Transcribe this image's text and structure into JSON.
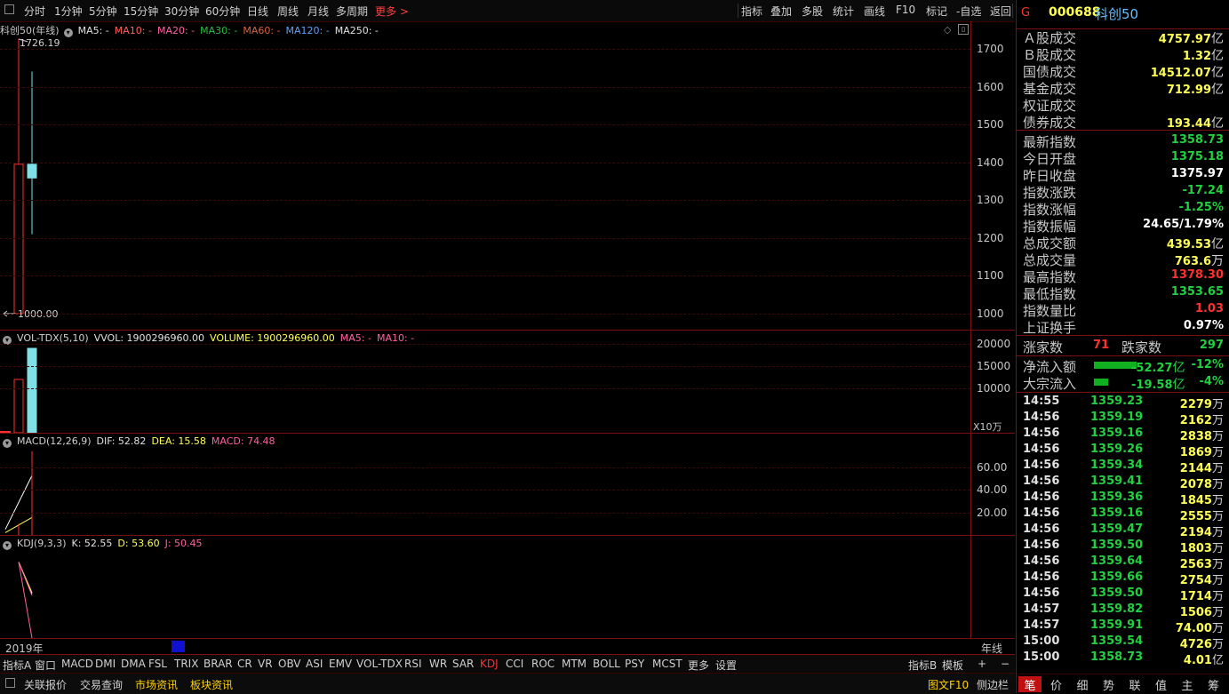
{
  "toolbar": {
    "left_items": [
      "分时",
      "1分钟",
      "5分钟",
      "15分钟",
      "30分钟",
      "60分钟",
      "日线",
      "周线",
      "月线",
      "多周期"
    ],
    "more_label": "更多 >",
    "right_items": [
      "指标",
      "叠加",
      "多股",
      "统计",
      "画线",
      "F10",
      "标记",
      "-自选",
      "返回"
    ]
  },
  "main_panel": {
    "name": "科创50(年线)",
    "ma_labels": [
      {
        "text": "MA5: -",
        "color": "#e0e0e0"
      },
      {
        "text": "MA10: -",
        "color": "#ff6060"
      },
      {
        "text": "MA20: -",
        "color": "#ff60a0"
      },
      {
        "text": "MA30: -",
        "color": "#20c040"
      },
      {
        "text": "MA60: -",
        "color": "#e06040"
      },
      {
        "text": "MA120: -",
        "color": "#60a0ff"
      },
      {
        "text": "MA250: -",
        "color": "#e0e0e0"
      }
    ],
    "y_ticks": [
      "1700",
      "1600",
      "1500",
      "1400",
      "1300",
      "1200",
      "1100",
      "1000"
    ],
    "high_label": "1726.19",
    "low_label": "1000.00"
  },
  "chart_data": [
    {
      "type": "candlestick",
      "title": "科创50(年线)",
      "ylim": [
        980,
        1760
      ],
      "candles": [
        {
          "open": 1000.0,
          "close": 1395.0,
          "high": 1726.19,
          "low": 1000.0,
          "color": "#ff3030"
        },
        {
          "open": 1395.0,
          "close": 1358.73,
          "high": 1640.0,
          "low": 1210.0,
          "color": "#80e0e8"
        }
      ]
    },
    {
      "type": "bar",
      "title": "VOL-TDX(5,10)",
      "ylim": [
        0,
        20000
      ],
      "values": [
        12000,
        19002
      ],
      "colors": [
        "#ff3030",
        "#80e0e8"
      ],
      "y_ticks": [
        "20000",
        "15000",
        "10000"
      ],
      "unit_label": "X10万"
    },
    {
      "type": "line",
      "title": "MACD(12,26,9)",
      "ylim": [
        0,
        75
      ],
      "series": [
        {
          "name": "DIF",
          "values": [
            5,
            52.82
          ],
          "color": "#ffffff"
        },
        {
          "name": "DEA",
          "values": [
            2,
            15.58
          ],
          "color": "#ffff55"
        }
      ],
      "bars": [
        0,
        74.48
      ],
      "y_ticks": [
        "60.00",
        "40.00",
        "20.00"
      ]
    },
    {
      "type": "line",
      "title": "KDJ(9,3,3)",
      "ylim": [
        0,
        100
      ],
      "series": [
        {
          "name": "K",
          "values": [
            90,
            52.55
          ],
          "color": "#ffffff"
        },
        {
          "name": "D",
          "values": [
            90,
            53.6
          ],
          "color": "#ffff55"
        },
        {
          "name": "J",
          "values": [
            90,
            50.45
          ],
          "color": "#ff60a0"
        }
      ]
    }
  ],
  "vol_panel": {
    "title": "VOL-TDX(5,10)",
    "vvol": "VVOL: 1900296960.00",
    "volume": "VOLUME: 1900296960.00",
    "ma5": "MA5: -",
    "ma10": "MA10: -"
  },
  "macd_panel": {
    "title": "MACD(12,26,9)",
    "dif": "DIF: 52.82",
    "dea": "DEA: 15.58",
    "macd": "MACD: 74.48"
  },
  "kdj_panel": {
    "title": "KDJ(9,3,3)",
    "k": "K: 52.55",
    "d": "D: 53.60",
    "j": "J: 50.45"
  },
  "time_axis": {
    "left_label": "2019年",
    "right_label": "年线"
  },
  "indicator_bar": {
    "items": [
      "指标A",
      "窗口",
      "MACD",
      "DMI",
      "DMA",
      "FSL",
      "TRIX",
      "BRAR",
      "CR",
      "VR",
      "OBV",
      "ASI",
      "EMV",
      "VOL-TDX",
      "RSI",
      "WR",
      "SAR",
      "KDJ",
      "CCI",
      "ROC",
      "MTM",
      "BOLL",
      "PSY",
      "MCST",
      "更多",
      "设置"
    ],
    "active": "KDJ",
    "right_items": [
      "指标B",
      "模板",
      "+",
      "−"
    ]
  },
  "bottom_bar": {
    "items": [
      "关联报价",
      "交易查询",
      "市场资讯",
      "板块资讯"
    ],
    "highlight": [
      "市场资讯",
      "板块资讯"
    ],
    "right_items": [
      "图文F10",
      "侧边栏"
    ]
  },
  "right_panel": {
    "mark": "G",
    "code": "000688",
    "name": "科创50",
    "summary": [
      {
        "label": "Ａ股成交",
        "value": "4757.97",
        "unit": "亿"
      },
      {
        "label": "Ｂ股成交",
        "value": "1.32",
        "unit": "亿"
      },
      {
        "label": "国债成交",
        "value": "14512.07",
        "unit": "亿"
      },
      {
        "label": "基金成交",
        "value": "712.99",
        "unit": "亿"
      },
      {
        "label": "权证成交",
        "value": "",
        "unit": ""
      },
      {
        "label": "债券成交",
        "value": "193.44",
        "unit": "亿"
      }
    ],
    "quote": [
      {
        "label": "最新指数",
        "value": "1358.73",
        "color": "#20d040"
      },
      {
        "label": "今日开盘",
        "value": "1375.18",
        "color": "#20d040"
      },
      {
        "label": "昨日收盘",
        "value": "1375.97",
        "color": "#ffffff"
      },
      {
        "label": "指数涨跌",
        "value": "-17.24",
        "color": "#20d040"
      },
      {
        "label": "指数涨幅",
        "value": "-1.25%",
        "color": "#20d040"
      },
      {
        "label": "指数振幅",
        "value": "24.65/1.79%",
        "color": "#ffffff"
      },
      {
        "label": "总成交额",
        "value": "439.53",
        "unit": "亿",
        "color": "#ffff55"
      },
      {
        "label": "总成交量",
        "value": "763.6",
        "unit": "万",
        "color": "#ffff55"
      },
      {
        "label": "最高指数",
        "value": "1378.30",
        "color": "#ff3030"
      },
      {
        "label": "最低指数",
        "value": "1353.65",
        "color": "#20d040"
      },
      {
        "label": "指数量比",
        "value": "1.03",
        "color": "#ff3030"
      },
      {
        "label": "上证换手",
        "value": "0.97%",
        "color": "#ffffff"
      }
    ],
    "rise_label": "涨家数",
    "rise_value": "71",
    "fall_label": "跌家数",
    "fall_value": "297",
    "flows": [
      {
        "label": "净流入额",
        "value": "-52.27",
        "unit": "亿",
        "pct": "-12%",
        "level": 0.12
      },
      {
        "label": "大宗流入",
        "value": "-19.58",
        "unit": "亿",
        "pct": "-4%",
        "level": 0.04
      }
    ],
    "ticks": [
      {
        "time": "14:55",
        "price": "1359.23",
        "vol": "2279",
        "unit": "万"
      },
      {
        "time": "14:56",
        "price": "1359.19",
        "vol": "2162",
        "unit": "万"
      },
      {
        "time": "14:56",
        "price": "1359.16",
        "vol": "2838",
        "unit": "万"
      },
      {
        "time": "14:56",
        "price": "1359.26",
        "vol": "1869",
        "unit": "万"
      },
      {
        "time": "14:56",
        "price": "1359.34",
        "vol": "2144",
        "unit": "万"
      },
      {
        "time": "14:56",
        "price": "1359.41",
        "vol": "2078",
        "unit": "万"
      },
      {
        "time": "14:56",
        "price": "1359.36",
        "vol": "1845",
        "unit": "万"
      },
      {
        "time": "14:56",
        "price": "1359.16",
        "vol": "2555",
        "unit": "万"
      },
      {
        "time": "14:56",
        "price": "1359.47",
        "vol": "2194",
        "unit": "万"
      },
      {
        "time": "14:56",
        "price": "1359.50",
        "vol": "1803",
        "unit": "万"
      },
      {
        "time": "14:56",
        "price": "1359.64",
        "vol": "2563",
        "unit": "万"
      },
      {
        "time": "14:56",
        "price": "1359.66",
        "vol": "2754",
        "unit": "万"
      },
      {
        "time": "14:56",
        "price": "1359.50",
        "vol": "1714",
        "unit": "万"
      },
      {
        "time": "14:57",
        "price": "1359.82",
        "vol": "1506",
        "unit": "万"
      },
      {
        "time": "14:57",
        "price": "1359.91",
        "vol": "74.00",
        "unit": "万"
      },
      {
        "time": "15:00",
        "price": "1359.54",
        "vol": "4726",
        "unit": "万"
      },
      {
        "time": "15:00",
        "price": "1358.73",
        "vol": "4.01",
        "unit": "亿"
      }
    ],
    "tabs": [
      "笔",
      "价",
      "细",
      "势",
      "联",
      "值",
      "主",
      "筹"
    ],
    "active_tab": "笔"
  }
}
